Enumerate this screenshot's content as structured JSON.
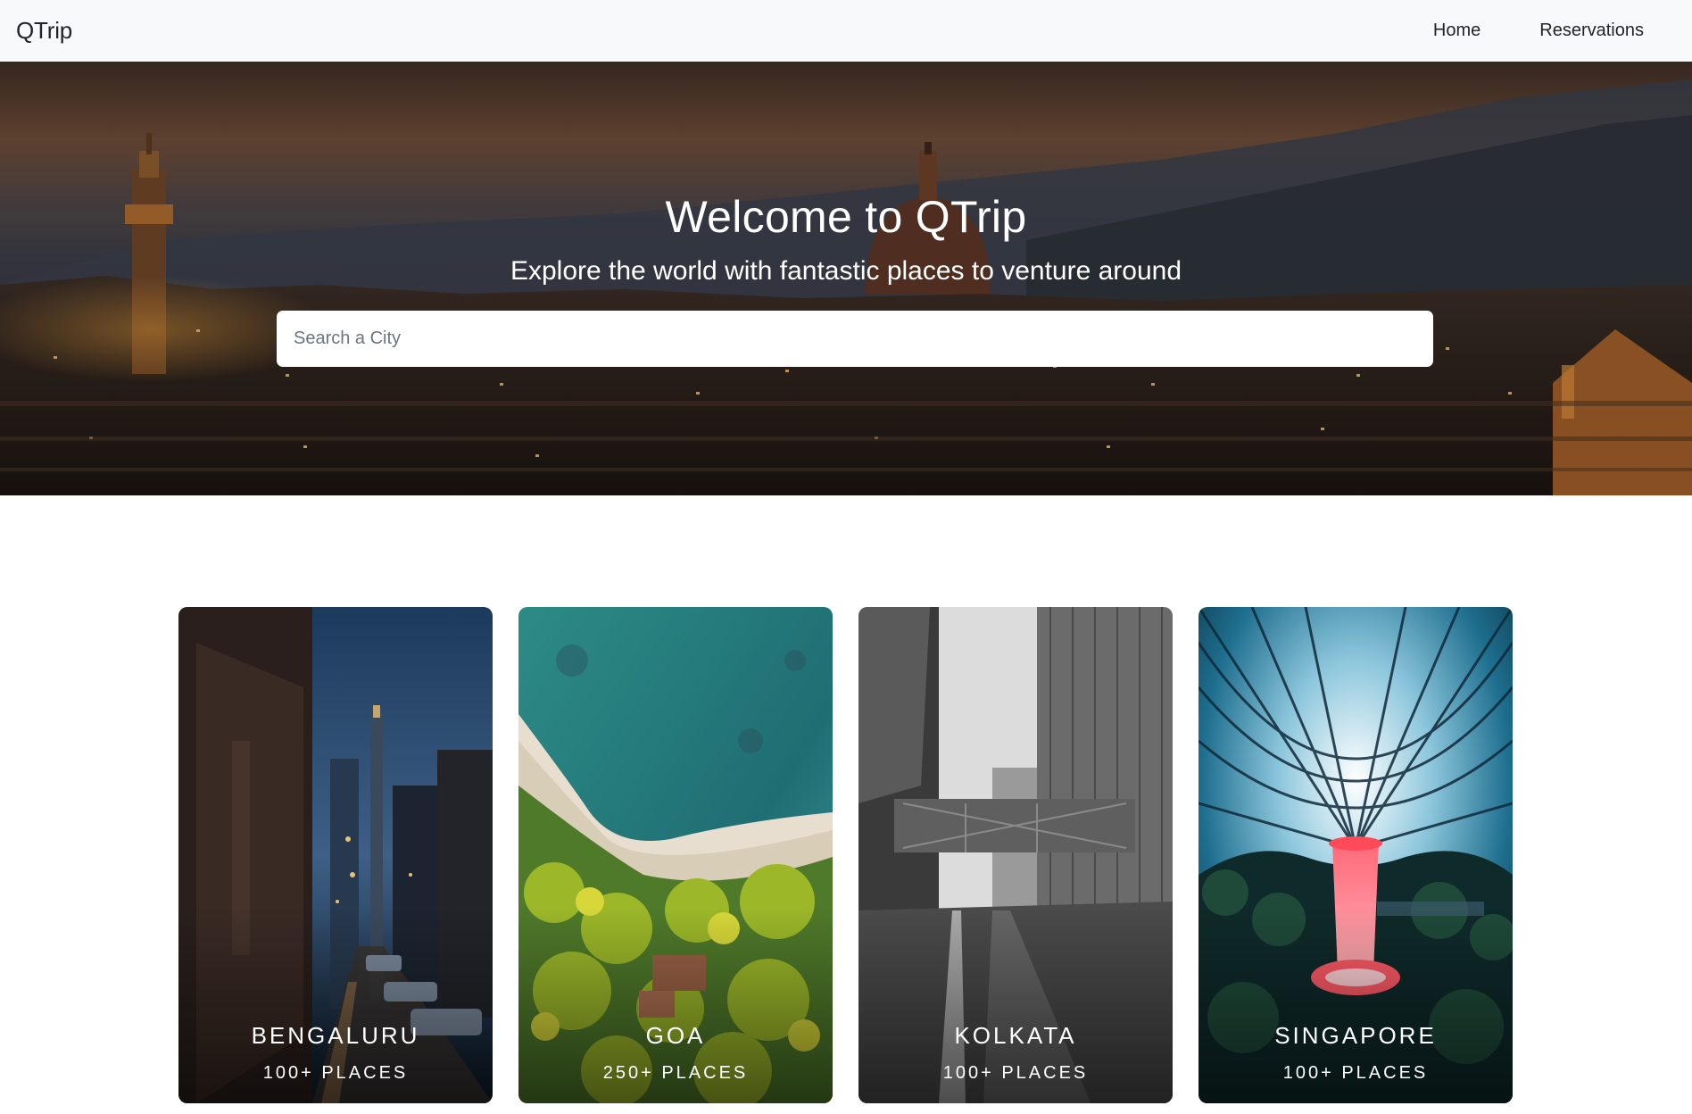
{
  "navbar": {
    "brand": "QTrip",
    "links": [
      {
        "label": "Home"
      },
      {
        "label": "Reservations"
      }
    ]
  },
  "hero": {
    "title": "Welcome to QTrip",
    "subtitle": "Explore the world with fantastic places to venture around",
    "search_placeholder": "Search a City"
  },
  "cities": [
    {
      "name": "BENGALURU",
      "places": "100+ PLACES"
    },
    {
      "name": "GOA",
      "places": "250+ PLACES"
    },
    {
      "name": "KOLKATA",
      "places": "100+ PLACES"
    },
    {
      "name": "SINGAPORE",
      "places": "100+ PLACES"
    }
  ]
}
